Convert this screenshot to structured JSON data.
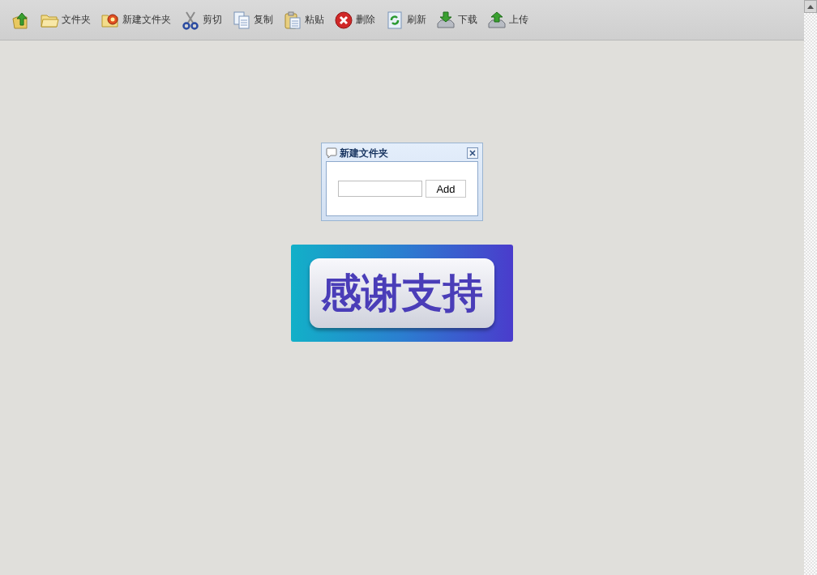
{
  "toolbar": [
    {
      "kind": "up"
    },
    {
      "kind": "folder",
      "label": "文件夹"
    },
    {
      "kind": "new-folder",
      "label": "新建文件夹"
    },
    {
      "kind": "cut",
      "label": "剪切"
    },
    {
      "kind": "copy",
      "label": "复制"
    },
    {
      "kind": "paste",
      "label": "粘贴"
    },
    {
      "kind": "delete",
      "label": "删除"
    },
    {
      "kind": "refresh",
      "label": "刷新"
    },
    {
      "kind": "download",
      "label": "下载"
    },
    {
      "kind": "upload",
      "label": "上传"
    }
  ],
  "dialog": {
    "title": "新建文件夹",
    "button": "Add"
  },
  "banner": {
    "text": "感谢支持"
  }
}
